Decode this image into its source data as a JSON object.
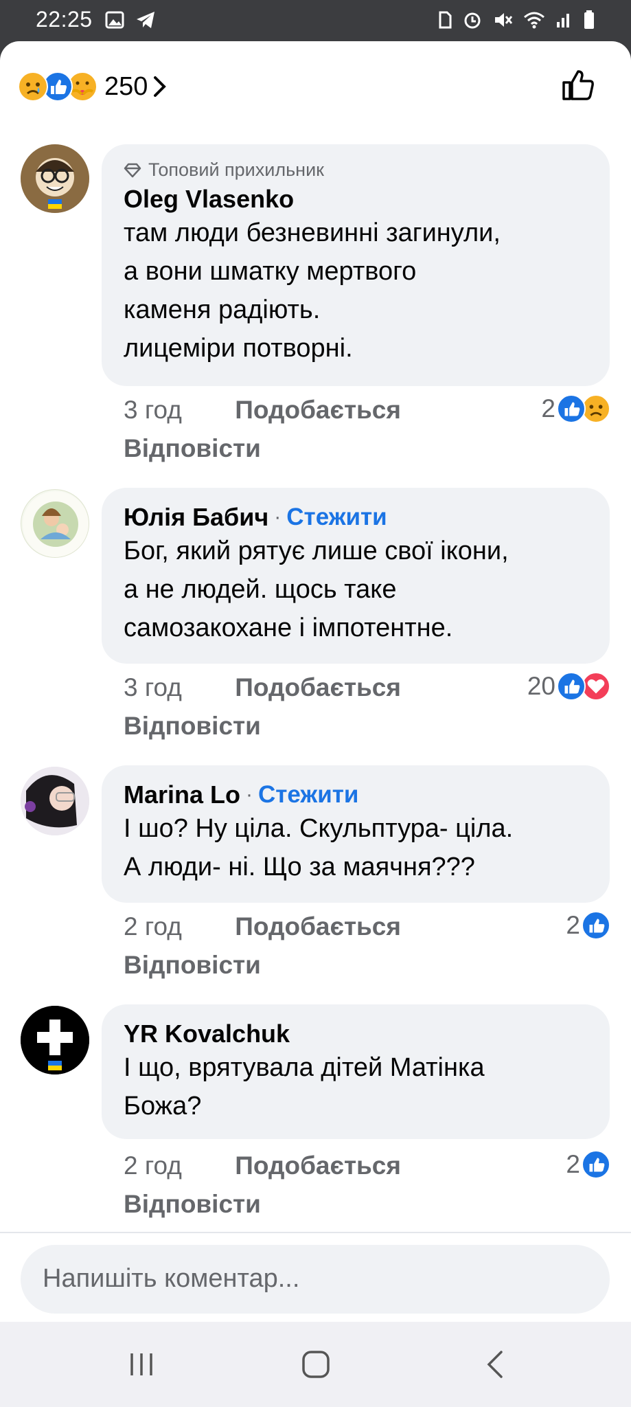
{
  "status_bar": {
    "time": "22:25"
  },
  "reactions_summary": {
    "count": "250"
  },
  "comments": [
    {
      "badge": "Топовий прихильник",
      "name": "Oleg Vlasenko",
      "follow": "",
      "text_lines": [
        "там люди безневинні загинули,",
        "а вони шматку мертвого",
        "каменя радіють.",
        "лицеміри потворні."
      ],
      "time": "3 год",
      "like_label": "Подобається",
      "reply_label": "Відповісти",
      "reaction_count": "2",
      "reaction_icons": [
        "like-icon",
        "sad-icon"
      ]
    },
    {
      "badge": "",
      "name": "Юлія Бабич",
      "follow": "Стежити",
      "text_lines": [
        "Бог, який рятує лише свої ікони,",
        "а не людей. щось таке",
        "самозакохане і імпотентне."
      ],
      "time": "3 год",
      "like_label": "Подобається",
      "reply_label": "Відповісти",
      "reaction_count": "20",
      "reaction_icons": [
        "like-icon",
        "love-icon"
      ]
    },
    {
      "badge": "",
      "name": "Marina Lo",
      "follow": "Стежити",
      "text_lines": [
        "І шо? Ну ціла. Скульптура- ціла.",
        "А люди- ні. Що за маячня???"
      ],
      "time": "2 год",
      "like_label": "Подобається",
      "reply_label": "Відповісти",
      "reaction_count": "2",
      "reaction_icons": [
        "like-icon"
      ]
    },
    {
      "badge": "",
      "name": "YR Kovalchuk",
      "follow": "",
      "text_lines": [
        "І що, врятувала дітей Матінка",
        "Божа?"
      ],
      "time": "2 год",
      "like_label": "Подобається",
      "reply_label": "Відповісти",
      "reaction_count": "2",
      "reaction_icons": [
        "like-icon"
      ]
    }
  ],
  "composer": {
    "placeholder": "Напишіть коментар..."
  },
  "colors": {
    "accent": "#1b74e4",
    "bubble": "#f0f2f5",
    "secondary_text": "#65676b"
  }
}
